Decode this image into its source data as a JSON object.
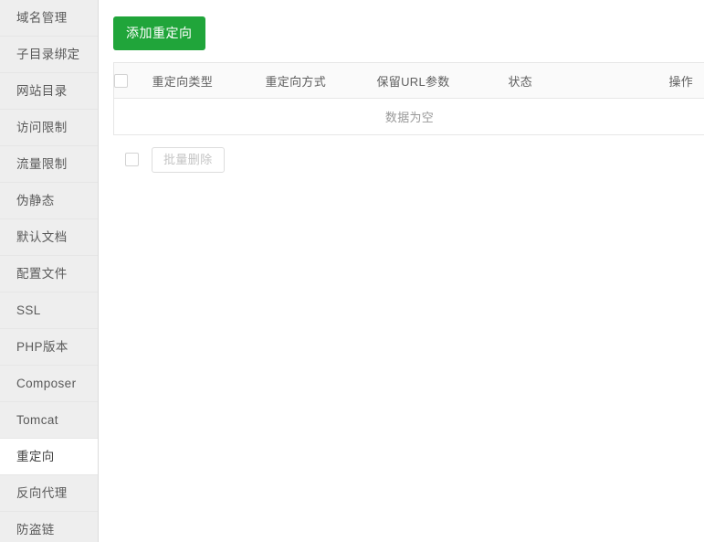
{
  "sidebar": {
    "items": [
      {
        "label": "域名管理",
        "active": false
      },
      {
        "label": "子目录绑定",
        "active": false
      },
      {
        "label": "网站目录",
        "active": false
      },
      {
        "label": "访问限制",
        "active": false
      },
      {
        "label": "流量限制",
        "active": false
      },
      {
        "label": "伪静态",
        "active": false
      },
      {
        "label": "默认文档",
        "active": false
      },
      {
        "label": "配置文件",
        "active": false
      },
      {
        "label": "SSL",
        "active": false
      },
      {
        "label": "PHP版本",
        "active": false
      },
      {
        "label": "Composer",
        "active": false
      },
      {
        "label": "Tomcat",
        "active": false
      },
      {
        "label": "重定向",
        "active": true
      },
      {
        "label": "反向代理",
        "active": false
      },
      {
        "label": "防盗链",
        "active": false
      }
    ]
  },
  "toolbar": {
    "add_redirect_label": "添加重定向",
    "add_button_color": "#20a53a"
  },
  "table": {
    "headers": {
      "select_all": "",
      "type": "重定向类型",
      "method": "重定向方式",
      "keep_url_params": "保留URL参数",
      "status": "状态",
      "action": "操作"
    },
    "empty_text": "数据为空",
    "rows": []
  },
  "footer": {
    "bulk_delete_label": "批量删除",
    "bulk_delete_disabled": true
  }
}
